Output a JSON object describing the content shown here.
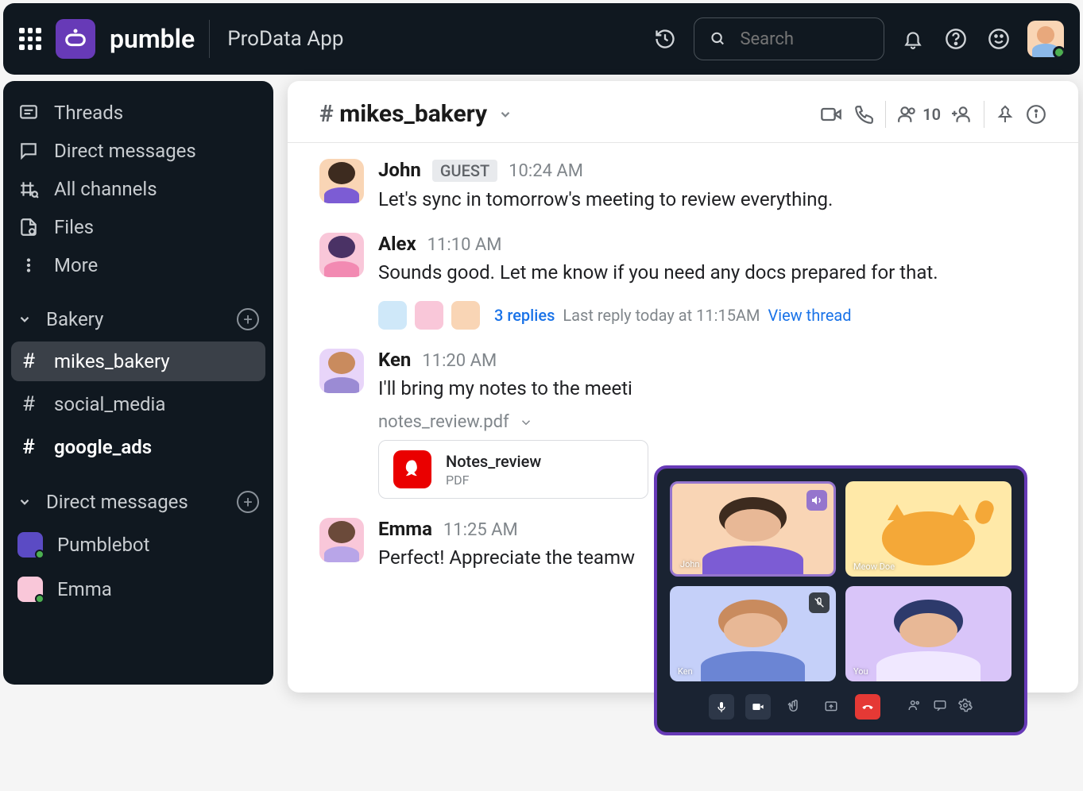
{
  "header": {
    "brand": "pumble",
    "appName": "ProData App",
    "searchPlaceholder": "Search"
  },
  "sidebar": {
    "nav": [
      {
        "label": "Threads",
        "icon": "threads"
      },
      {
        "label": "Direct messages",
        "icon": "dm"
      },
      {
        "label": "All channels",
        "icon": "channels"
      },
      {
        "label": "Files",
        "icon": "files"
      },
      {
        "label": "More",
        "icon": "more"
      }
    ],
    "sections": [
      {
        "title": "Bakery",
        "items": [
          {
            "name": "mikes_bakery",
            "active": true,
            "bold": false
          },
          {
            "name": "social_media",
            "active": false,
            "bold": false
          },
          {
            "name": "google_ads",
            "active": false,
            "bold": true
          }
        ]
      },
      {
        "title": "Direct messages",
        "items": [
          {
            "name": "Pumblebot",
            "avatarBg": "#5b4bc4",
            "presence": true
          },
          {
            "name": "Emma",
            "avatarBg": "#f9c7d9",
            "presence": true
          }
        ]
      }
    ]
  },
  "channel": {
    "name": "mikes_bakery",
    "memberCount": "10"
  },
  "messages": [
    {
      "author": "John",
      "badge": "GUEST",
      "time": "10:24 AM",
      "text": "Let's sync in tomorrow's meeting to review everything.",
      "avatarBg": "#f9d5b5",
      "hairBg": "#3d2b1f",
      "bodyBg": "#7c5cd4"
    },
    {
      "author": "Alex",
      "time": "11:10 AM",
      "text": "Sounds good. Let me know if you need any docs prepared for that.",
      "avatarBg": "#f9c7d9",
      "hairBg": "#4a3265",
      "bodyBg": "#f28ab2",
      "thread": {
        "replies": "3 replies",
        "lastReply": "Last reply today at 11:15AM",
        "viewThread": "View thread",
        "avatars": [
          "#cfe8f9",
          "#f9c7d9",
          "#f9d5b5"
        ]
      }
    },
    {
      "author": "Ken",
      "time": "11:20 AM",
      "text": "I'll bring my notes to the meeti",
      "avatarBg": "#e8d5f9",
      "hairBg": "#c98b5e",
      "bodyBg": "#9b8bd4",
      "file": {
        "label": "notes_review.pdf",
        "cardName": "Notes_review",
        "cardType": "PDF"
      }
    },
    {
      "author": "Emma",
      "time": "11:25 AM",
      "text": "Perfect! Appreciate the teamw",
      "avatarBg": "#f9c7d9",
      "hairBg": "#6b4a3a",
      "bodyBg": "#b8a5e8"
    }
  ],
  "call": {
    "tiles": [
      {
        "name": "John",
        "bg": "#f9d5b5",
        "badge": "volume",
        "active": true,
        "hairBg": "#3d2b1f",
        "bodyBg": "#7c5cd4"
      },
      {
        "name": "Meow Doe",
        "bg": "#ffe9a8",
        "isCat": true
      },
      {
        "name": "Ken",
        "bg": "#c5d0f9",
        "badge": "mute",
        "hairBg": "#c98b5e",
        "bodyBg": "#6b85d4"
      },
      {
        "name": "You",
        "bg": "#d9c5f9",
        "hairBg": "#2d3a6b",
        "bodyBg": "#f0e8ff"
      }
    ]
  }
}
